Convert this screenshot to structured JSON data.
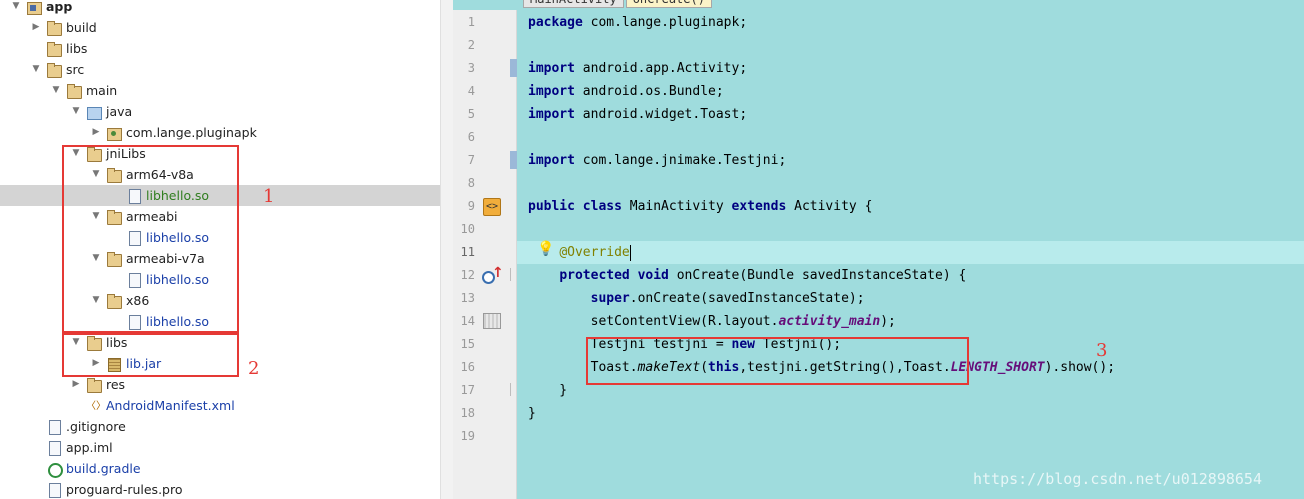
{
  "tree": {
    "rows": [
      {
        "label": "app",
        "indent": 0,
        "arrow": "▼",
        "icon": "module-folder-icon",
        "style": "plain",
        "bold": true
      },
      {
        "label": "build",
        "indent": 1,
        "arrow": "▶",
        "icon": "folder-icon",
        "style": "plain"
      },
      {
        "label": "libs",
        "indent": 1,
        "arrow": "",
        "icon": "folder-icon",
        "style": "plain"
      },
      {
        "label": "src",
        "indent": 1,
        "arrow": "▼",
        "icon": "folder-icon",
        "style": "plain"
      },
      {
        "label": "main",
        "indent": 2,
        "arrow": "▼",
        "icon": "folder-icon",
        "style": "plain"
      },
      {
        "label": "java",
        "indent": 3,
        "arrow": "▼",
        "icon": "source-folder-icon",
        "style": "plain"
      },
      {
        "label": "com.lange.pluginapk",
        "indent": 4,
        "arrow": "▶",
        "icon": "package-icon",
        "style": "plain"
      },
      {
        "label": "jniLibs",
        "indent": 3,
        "arrow": "▼",
        "icon": "folder-icon",
        "style": "plain"
      },
      {
        "label": "arm64-v8a",
        "indent": 4,
        "arrow": "▼",
        "icon": "folder-icon",
        "style": "plain"
      },
      {
        "label": "libhello.so",
        "indent": 5,
        "arrow": "",
        "icon": "file-icon",
        "style": "green"
      },
      {
        "label": "armeabi",
        "indent": 4,
        "arrow": "▼",
        "icon": "folder-icon",
        "style": "plain"
      },
      {
        "label": "libhello.so",
        "indent": 5,
        "arrow": "",
        "icon": "file-icon",
        "style": "blue"
      },
      {
        "label": "armeabi-v7a",
        "indent": 4,
        "arrow": "▼",
        "icon": "folder-icon",
        "style": "plain"
      },
      {
        "label": "libhello.so",
        "indent": 5,
        "arrow": "",
        "icon": "file-icon",
        "style": "blue"
      },
      {
        "label": "x86",
        "indent": 4,
        "arrow": "▼",
        "icon": "folder-icon",
        "style": "plain"
      },
      {
        "label": "libhello.so",
        "indent": 5,
        "arrow": "",
        "icon": "file-icon",
        "style": "blue"
      },
      {
        "label": "libs",
        "indent": 3,
        "arrow": "▼",
        "icon": "folder-icon",
        "style": "plain"
      },
      {
        "label": "lib.jar",
        "indent": 4,
        "arrow": "▶",
        "icon": "jar-icon",
        "style": "blue"
      },
      {
        "label": "res",
        "indent": 3,
        "arrow": "▶",
        "icon": "folder-icon",
        "style": "plain"
      },
      {
        "label": "AndroidManifest.xml",
        "indent": 3,
        "arrow": "",
        "icon": "xml-file-icon",
        "style": "blue"
      },
      {
        "label": ".gitignore",
        "indent": 1,
        "arrow": "",
        "icon": "file-icon",
        "style": "plain"
      },
      {
        "label": "app.iml",
        "indent": 1,
        "arrow": "",
        "icon": "file-icon",
        "style": "plain"
      },
      {
        "label": "build.gradle",
        "indent": 1,
        "arrow": "",
        "icon": "gradle-icon",
        "style": "blue"
      },
      {
        "label": "proguard-rules.pro",
        "indent": 1,
        "arrow": "",
        "icon": "file-icon",
        "style": "plain"
      }
    ],
    "selected_index": 9
  },
  "annotations": {
    "one": "1",
    "two": "2",
    "three": "3"
  },
  "editor": {
    "tabs": [
      {
        "label": "MainActivity",
        "active": false
      },
      {
        "label": "onCreate()",
        "active": true
      }
    ],
    "current_line": 11,
    "lines": [
      {
        "n": "1",
        "html": "<span class=\"kw\">package</span> com.lange.pluginapk;"
      },
      {
        "n": "2",
        "html": ""
      },
      {
        "n": "3",
        "html": "<span class=\"kw\">import</span> android.app.Activity;"
      },
      {
        "n": "4",
        "html": "<span class=\"kw\">import</span> android.os.Bundle;"
      },
      {
        "n": "5",
        "html": "<span class=\"kw\">import</span> android.widget.Toast;"
      },
      {
        "n": "6",
        "html": ""
      },
      {
        "n": "7",
        "html": "<span class=\"kw\">import</span> com.lange.jnimake.Testjni;"
      },
      {
        "n": "8",
        "html": ""
      },
      {
        "n": "9",
        "html": "<span class=\"kw\">public class</span> MainActivity <span class=\"kw\">extends</span> Activity {"
      },
      {
        "n": "10",
        "html": ""
      },
      {
        "n": "11",
        "html": "    <span class=\"ann\">@Override</span><span class=\"caret\"></span>"
      },
      {
        "n": "12",
        "html": "    <span class=\"kw\">protected void</span> onCreate(Bundle savedInstanceState) {"
      },
      {
        "n": "13",
        "html": "        <span class=\"kw\">super</span>.onCreate(savedInstanceState);"
      },
      {
        "n": "14",
        "html": "        setContentView(R.layout.<span class=\"const\">activity_main</span>);"
      },
      {
        "n": "15",
        "html": "        Testjni testjni = <span class=\"kw\">new</span> Testjni();"
      },
      {
        "n": "16",
        "html": "        Toast.<span class=\"it\">makeText</span>(<span class=\"kw\">this</span>,testjni.getString(),Toast.<span class=\"const\">LENGTH_SHORT</span>).show();"
      },
      {
        "n": "17",
        "html": "    }"
      },
      {
        "n": "18",
        "html": "}"
      },
      {
        "n": "19",
        "html": ""
      }
    ]
  },
  "watermark": "https://blog.csdn.net/u012898654",
  "colors": {
    "editor_bg": "#9fdcdd",
    "highlight": "#e53935",
    "keyword": "#000080",
    "annotation": "#808000"
  }
}
